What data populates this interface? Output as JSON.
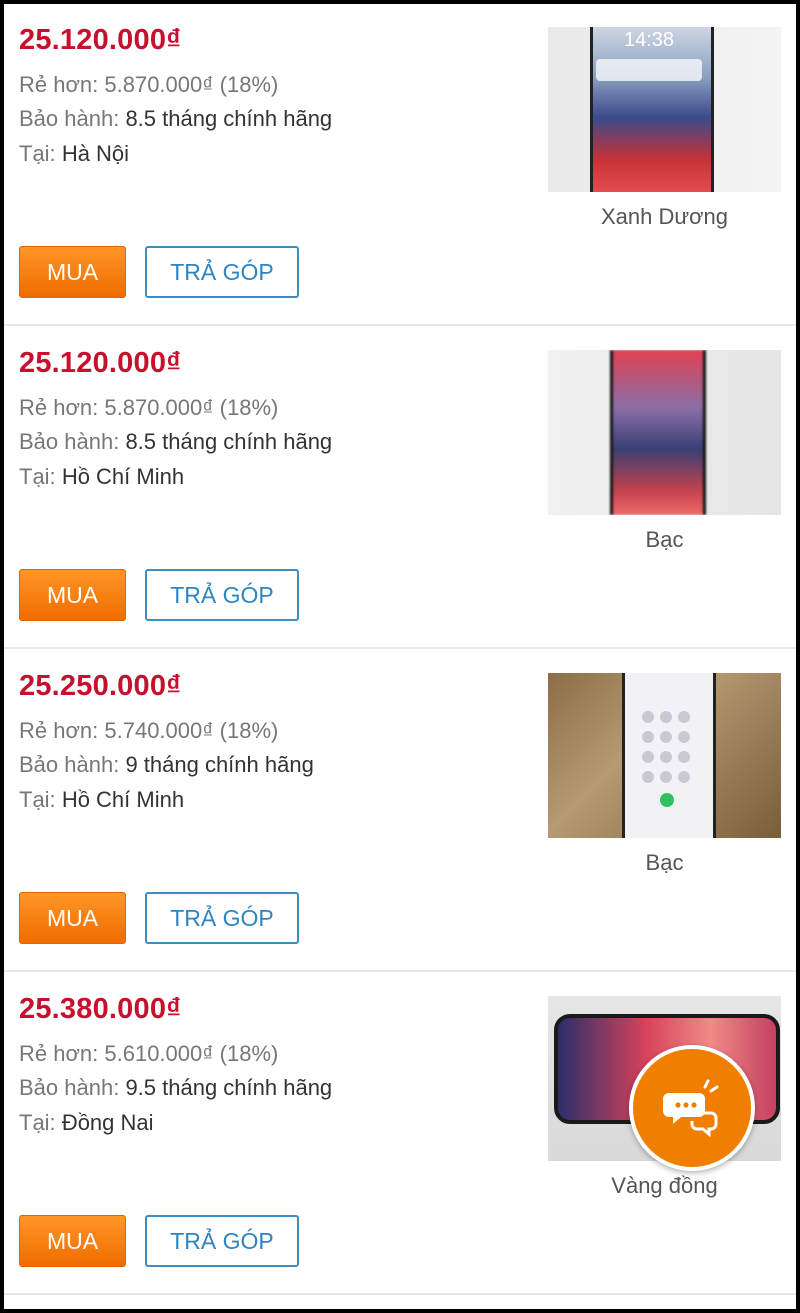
{
  "labels": {
    "cheaper": "Rẻ hơn:",
    "warranty": "Bảo hành:",
    "location": "Tại:",
    "buy": "MUA",
    "installment": "TRẢ GÓP"
  },
  "listings": [
    {
      "price": "25.120.000₫",
      "cheaper_by": "5.870.000₫ (18%)",
      "warranty": "8.5 tháng chính hãng",
      "location": "Hà Nội",
      "color": "Xanh Dương",
      "thumb_time": "14:38"
    },
    {
      "price": "25.120.000₫",
      "cheaper_by": "5.870.000₫ (18%)",
      "warranty": "8.5 tháng chính hãng",
      "location": "Hồ Chí Minh",
      "color": "Bạc"
    },
    {
      "price": "25.250.000₫",
      "cheaper_by": "5.740.000₫ (18%)",
      "warranty": "9 tháng chính hãng",
      "location": "Hồ Chí Minh",
      "color": "Bạc"
    },
    {
      "price": "25.380.000₫",
      "cheaper_by": "5.610.000₫ (18%)",
      "warranty": "9.5 tháng chính hãng",
      "location": "Đồng Nai",
      "color": "Vàng đồng"
    }
  ],
  "colors": {
    "price": "#c8102e",
    "buy_button": "#f47a10",
    "installment_border": "#3a8fc6",
    "chat_button": "#f07e00"
  },
  "icons": {
    "chat": "chat-bubbles-icon"
  }
}
